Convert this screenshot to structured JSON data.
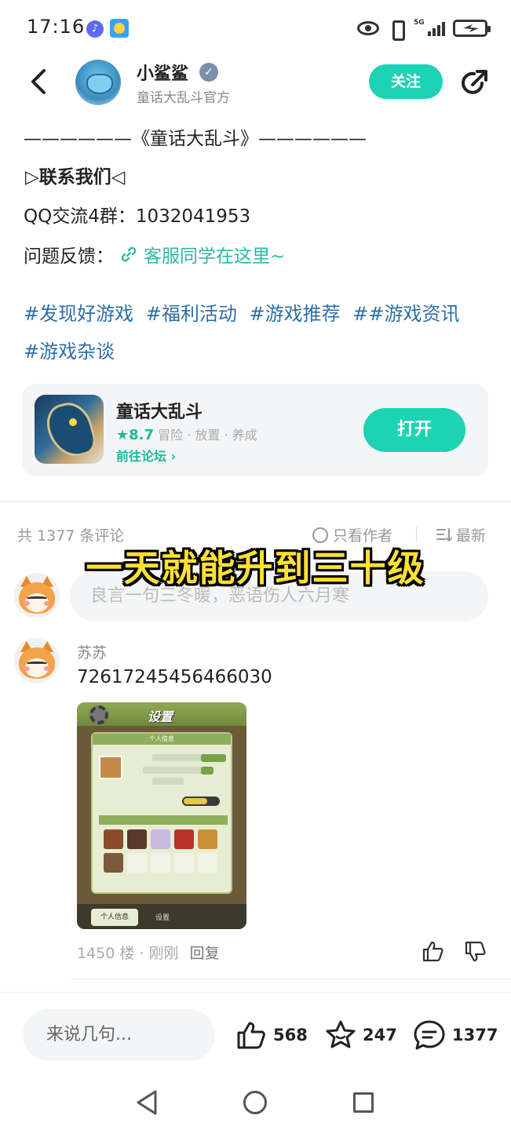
{
  "status_bar": {
    "time": "17:16",
    "network": "5G"
  },
  "header": {
    "username": "小鲨鲨",
    "subtitle": "童话大乱斗官方",
    "follow_label": "关注"
  },
  "post": {
    "divider_title": "——————《童话大乱斗》——————",
    "contact_heading": "▷联系我们◁",
    "qq_group": "QQ交流4群：1032041953",
    "feedback_label": "问题反馈：",
    "feedback_link": "客服同学在这里~",
    "tags": [
      "#发现好游戏",
      "#福利活动",
      "#游戏推荐",
      "##游戏资讯",
      "#游戏杂谈"
    ]
  },
  "game_card": {
    "name": "童话大乱斗",
    "score": "★8.7",
    "genres": "冒险 · 放置 · 养成",
    "forum_link": "前往论坛 ›",
    "open_label": "打开"
  },
  "comments": {
    "count_label": "共 1377 条评论",
    "only_author": "只看作者",
    "sort_latest": "最新",
    "overlay_caption": "一天就能升到三十级",
    "input_placeholder": "良言一句三冬暖，恶语伤人六月寒",
    "items": [
      {
        "author": "苏苏",
        "text": "72617245456466030",
        "image_title": "设置",
        "image_panel_header": "个人信息",
        "image_tab_1": "个人信息",
        "image_tab_2": "设置",
        "floor": "1450 楼 · 刚刚",
        "reply_label": "回复"
      }
    ]
  },
  "bottom_bar": {
    "input_placeholder": "来说几句...",
    "likes": "568",
    "favorites": "247",
    "comments": "1377"
  },
  "colors": {
    "accent": "#1cd3b4",
    "tag_blue": "#2d6fa8",
    "caption_yellow": "#ffe033"
  }
}
